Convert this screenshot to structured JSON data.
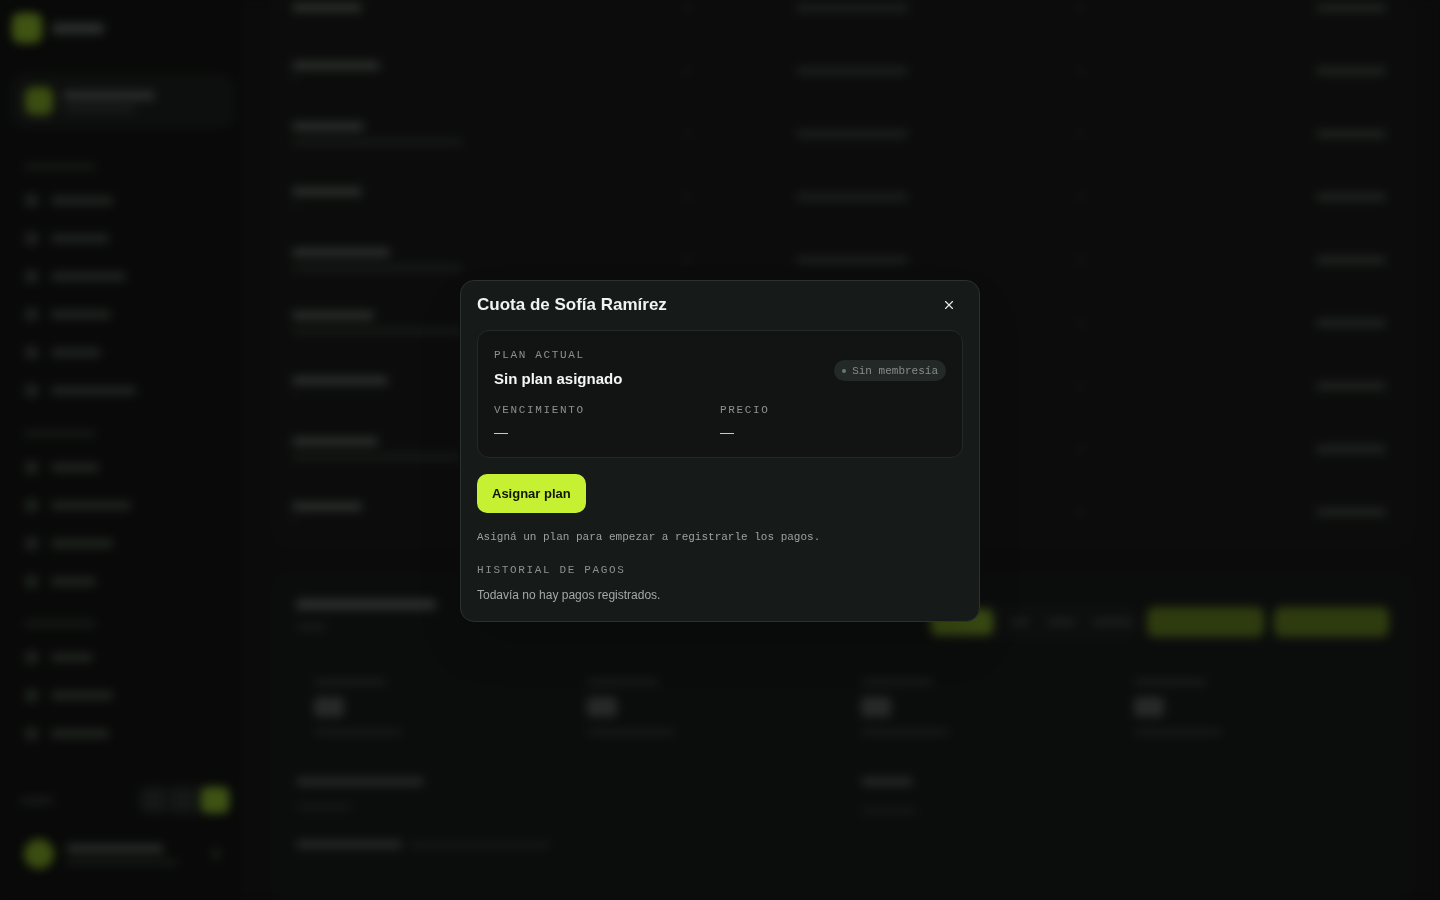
{
  "dialog": {
    "title": "Cuota de Sofía Ramírez",
    "plan_card": {
      "label": "PLAN ACTUAL",
      "plan_name": "Sin plan asignado",
      "status_badge": "Sin membresía",
      "fields": [
        {
          "label": "VENCIMIENTO",
          "value": "—"
        },
        {
          "label": "PRECIO",
          "value": "—"
        }
      ]
    },
    "assign_button": "Asignar plan",
    "hint": "Asigná un plan para empezar a registrarle los pagos.",
    "history": {
      "title": "HISTORIAL DE PAGOS",
      "empty_message": "Todavía no hay pagos registrados."
    }
  }
}
